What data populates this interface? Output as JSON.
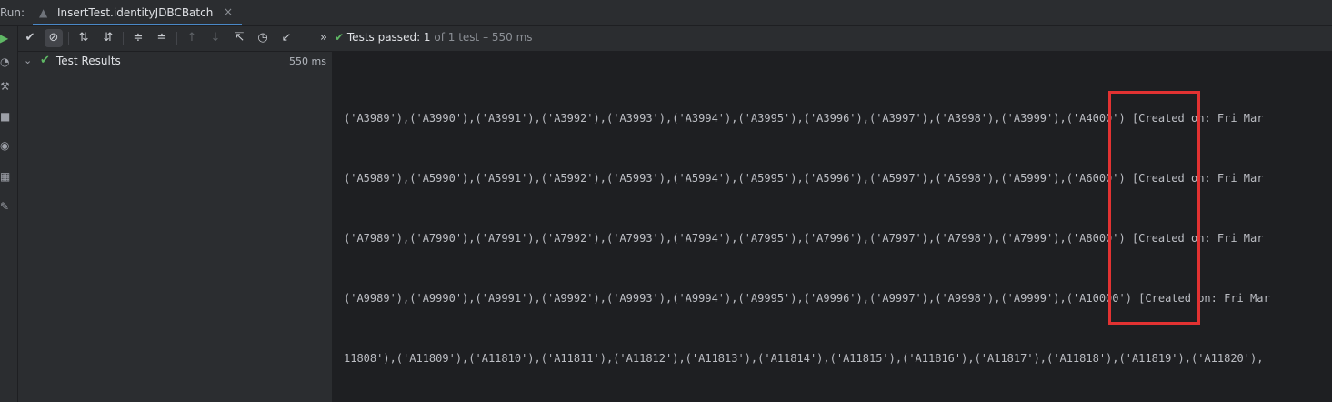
{
  "header": {
    "run_label": "Run:",
    "tab_title": "InsertTest.identityJDBCBatch",
    "tab_close": "×"
  },
  "toolbar": {
    "status_check": "✔",
    "status_prefix": "Tests passed: ",
    "status_passed": "1",
    "status_rest": " of 1 test – 550 ms",
    "more": "»"
  },
  "tree": {
    "chevron": "⌄",
    "check": "✔",
    "root_label": "Test Results",
    "root_time": "550 ms"
  },
  "console": {
    "lines": [
      "('A3989'),('A3990'),('A3991'),('A3992'),('A3993'),('A3994'),('A3995'),('A3996'),('A3997'),('A3998'),('A3999'),('A4000') [Created on: Fri Mar",
      "('A5989'),('A5990'),('A5991'),('A5992'),('A5993'),('A5994'),('A5995'),('A5996'),('A5997'),('A5998'),('A5999'),('A6000') [Created on: Fri Mar",
      "('A7989'),('A7990'),('A7991'),('A7992'),('A7993'),('A7994'),('A7995'),('A7996'),('A7997'),('A7998'),('A7999'),('A8000') [Created on: Fri Mar",
      "('A9989'),('A9990'),('A9991'),('A9992'),('A9993'),('A9994'),('A9995'),('A9996'),('A9997'),('A9998'),('A9999'),('A10000') [Created on: Fri Mar",
      "11808'),('A11809'),('A11810'),('A11811'),('A11812'),('A11813'),('A11814'),('A11815'),('A11816'),('A11817'),('A11818'),('A11819'),('A11820'),"
    ]
  },
  "colors": {
    "highlight": "#e23232",
    "pass_green": "#5fb865",
    "accent": "#4a88c7"
  }
}
